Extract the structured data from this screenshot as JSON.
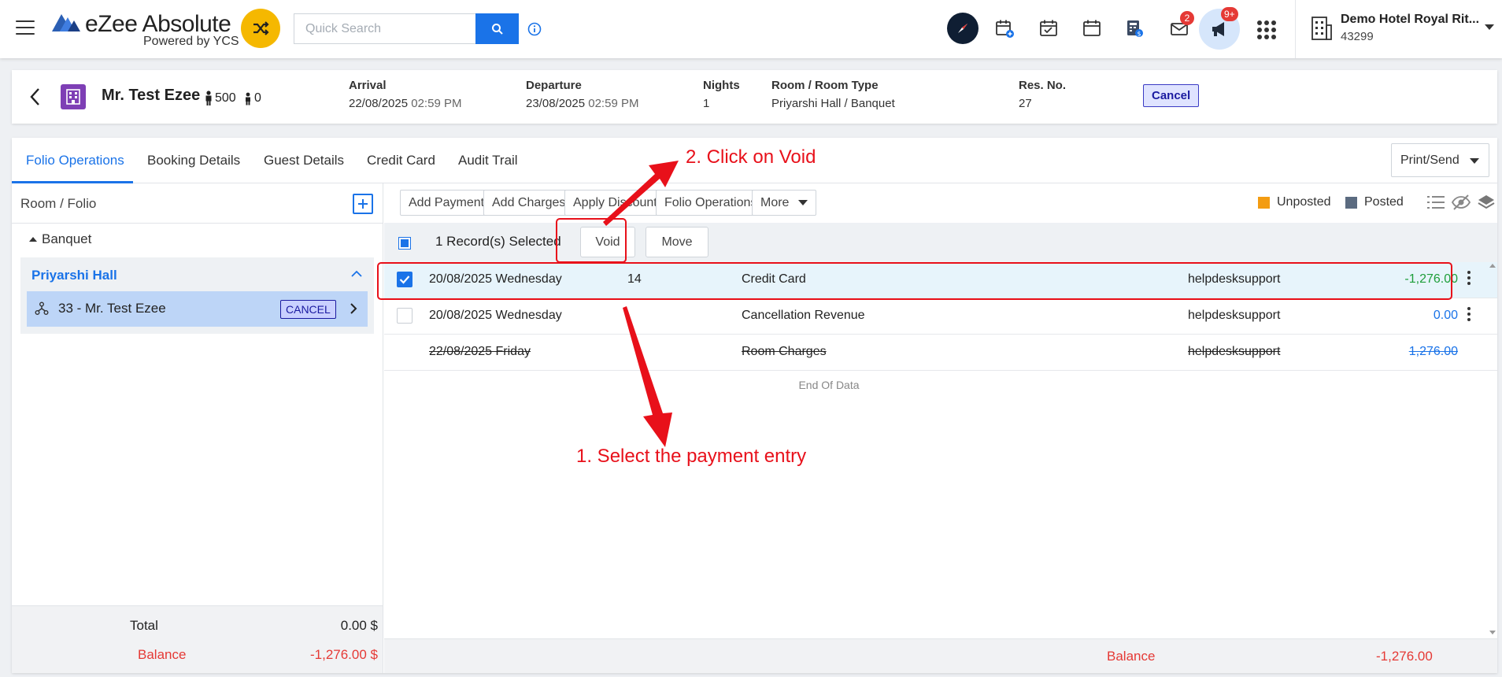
{
  "app": {
    "logo_title": "eZee Absolute",
    "logo_sub": "Powered by YCS",
    "search_placeholder": "Quick Search",
    "notifications": {
      "mail_badge": "2",
      "announce_badge": "9+"
    },
    "hotel": {
      "name": "Demo Hotel Royal Rit...",
      "id": "43299"
    }
  },
  "reservation": {
    "guest_name": "Mr. Test Ezee",
    "adults": "500",
    "children": "0",
    "fields": {
      "arrival_label": "Arrival",
      "arrival_date": "22/08/2025",
      "arrival_time": "02:59 PM",
      "departure_label": "Departure",
      "departure_date": "23/08/2025",
      "departure_time": "02:59 PM",
      "nights_label": "Nights",
      "nights_value": "1",
      "room_label": "Room / Room Type",
      "room_value": "Priyarshi Hall / Banquet",
      "resno_label": "Res. No.",
      "resno_value": "27"
    },
    "status": "Cancel"
  },
  "tabs": [
    "Folio Operations",
    "Booking Details",
    "Guest Details",
    "Credit Card",
    "Audit Trail"
  ],
  "print_label": "Print/Send",
  "left_panel": {
    "title": "Room / Folio",
    "group": "Banquet",
    "room_name": "Priyarshi Hall",
    "folio_label": "33 - Mr. Test Ezee",
    "folio_status": "CANCEL",
    "total_label": "Total",
    "total_value": "0.00 $",
    "balance_label": "Balance",
    "balance_value": "-1,276.00 $"
  },
  "toolbar": {
    "add_payment": "Add Payment",
    "add_charges": "Add Charges",
    "apply_discount": "Apply Discount",
    "folio_operations": "Folio Operations",
    "more": "More",
    "legend_unposted": "Unposted",
    "legend_posted": "Posted",
    "colors": {
      "unposted": "#f39c12",
      "posted": "#5b6b80"
    }
  },
  "selection": {
    "text": "1 Record(s) Selected",
    "void": "Void",
    "move": "Move"
  },
  "transactions": [
    {
      "date": "20/08/2025 Wednesday",
      "ref": "14",
      "description": "Credit Card",
      "user": "helpdesksupport",
      "amount": "-1,276.00",
      "amount_color": "#1e9e3a",
      "selected": true,
      "voided": false
    },
    {
      "date": "20/08/2025 Wednesday",
      "ref": "",
      "description": "Cancellation Revenue",
      "user": "helpdesksupport",
      "amount": "0.00",
      "amount_color": "#1a73e8",
      "selected": false,
      "voided": false
    },
    {
      "date": "22/08/2025 Friday",
      "ref": "",
      "description": "Room Charges",
      "user": "helpdesksupport",
      "amount": "1,276.00",
      "amount_color": "#1a73e8",
      "selected": false,
      "voided": true
    }
  ],
  "end_of_data": "End Of Data",
  "footer": {
    "balance_label": "Balance",
    "balance_value": "-1,276.00"
  },
  "annotations": {
    "step2": "2. Click on Void",
    "step1": "1. Select the payment entry",
    "color": "#e8101a"
  }
}
